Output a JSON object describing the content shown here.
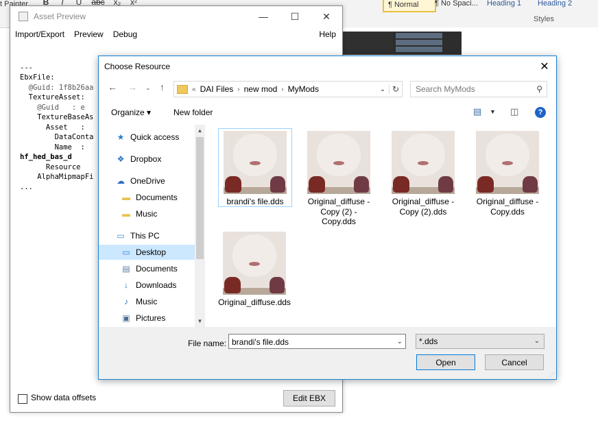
{
  "ribbon": {
    "left_text": "t Painter",
    "fmt": [
      "B",
      "I",
      "U",
      "abc",
      "x₂",
      "x²"
    ],
    "styles": [
      "¶ Normal",
      "¶ No Spaci...",
      "Heading 1",
      "Heading 2"
    ],
    "styles_label": "Styles"
  },
  "asset": {
    "title": "Asset Preview",
    "controls": [
      "—",
      "☐",
      "✕"
    ],
    "menu": [
      "Import/Export",
      "Preview",
      "Debug"
    ],
    "help": "Help",
    "code_lines": [
      "---",
      "EbxFile:",
      "  @Guid: 1f8b26aa",
      "  TextureAsset:",
      "    @Guid   : e",
      "    TextureBaseAs",
      "      Asset   :",
      "        DataConta",
      "        Name  :",
      "hf_hed_bas_d",
      "      Resource",
      "    AlphaMipmapFi",
      "..."
    ],
    "show_offsets": "Show data offsets",
    "edit_button": "Edit EBX"
  },
  "dialog": {
    "title": "Choose Resource",
    "close": "✕",
    "breadcrumb": [
      "«",
      "DAI Files",
      "›",
      "new mod",
      "›",
      "MyMods"
    ],
    "search_placeholder": "Search MyMods",
    "organize": "Organize ▾",
    "new_folder": "New folder",
    "help": "?",
    "nav": [
      {
        "label": "Quick access",
        "icon": "★"
      },
      {
        "label": "Dropbox",
        "icon": "❖"
      },
      {
        "label": "OneDrive",
        "icon": "☁"
      },
      {
        "label": "Documents",
        "icon": "▬"
      },
      {
        "label": "Music",
        "icon": "▬"
      },
      {
        "label": "This PC",
        "icon": "▭"
      },
      {
        "label": "Desktop",
        "icon": "▭"
      },
      {
        "label": "Documents",
        "icon": "▤"
      },
      {
        "label": "Downloads",
        "icon": "↓"
      },
      {
        "label": "Music",
        "icon": "♪"
      },
      {
        "label": "Pictures",
        "icon": "▣"
      }
    ],
    "files": [
      "brandi's file.dds",
      "Original_diffuse - Copy (2) - Copy.dds",
      "Original_diffuse - Copy (2).dds",
      "Original_diffuse - Copy.dds",
      "Original_diffuse.dds"
    ],
    "file_name_label": "File name:",
    "file_name_value": "brandi's file.dds",
    "filter_value": "*.dds",
    "open": "Open",
    "cancel": "Cancel"
  }
}
